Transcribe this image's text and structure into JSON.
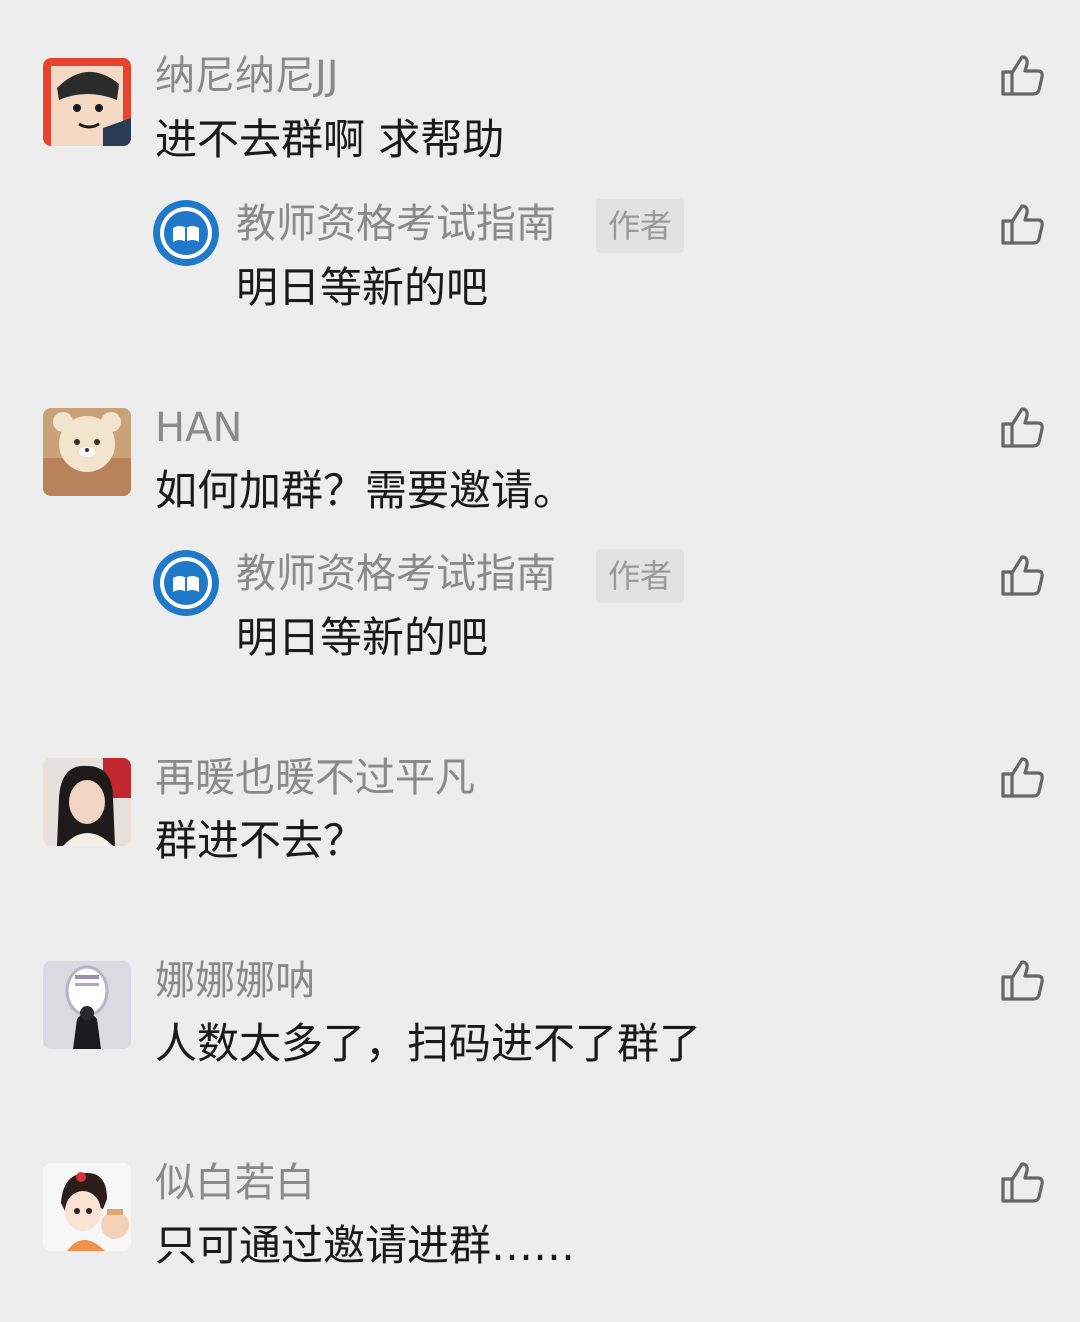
{
  "comments": [
    {
      "nickname": "纳尼纳尼JJ",
      "text": "进不去群啊 求帮助",
      "reply": {
        "nickname": "教师资格考试指南",
        "badge": "作者",
        "text": "明日等新的吧"
      }
    },
    {
      "nickname": "HAN",
      "text": "如何加群？需要邀请。",
      "reply": {
        "nickname": "教师资格考试指南",
        "badge": "作者",
        "text": "明日等新的吧"
      }
    },
    {
      "nickname": "再暖也暖不过平凡",
      "text": "群进不去？"
    },
    {
      "nickname": "娜娜娜呐",
      "text": "人数太多了，扫码进不了群了"
    },
    {
      "nickname": "似白若白",
      "text": "只可通过邀请进群……"
    }
  ],
  "icons": {
    "like": "thumbs-up-icon",
    "reply_avatar": "book-logo-icon"
  },
  "colors": {
    "background": "#ededed",
    "nickname": "#8a8a8a",
    "text": "#1a1a1a",
    "badge_bg": "#e2e2e2",
    "logo_blue": "#1f78c8"
  }
}
